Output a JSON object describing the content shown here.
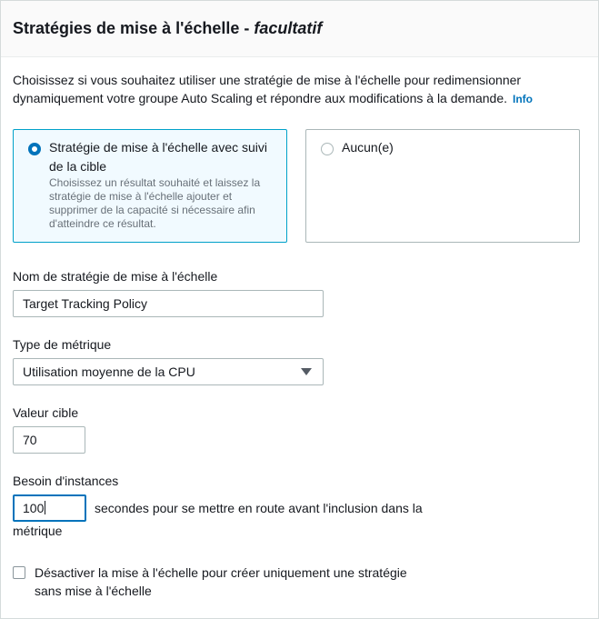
{
  "section": {
    "title": "Stratégies de mise à l'échelle - ",
    "title_italic": "facultatif",
    "description": "Choisissez si vous souhaitez utiliser une stratégie de mise à l'échelle pour redimensionner dynamiquement votre groupe Auto Scaling et répondre aux modifications à la demande.",
    "info_link": "Info"
  },
  "policy_options": [
    {
      "label": "Stratégie de mise à l'échelle avec suivi de la cible",
      "description": "Choisissez un résultat souhaité et laissez la stratégie de mise à l'échelle ajouter et supprimer de la capacité si nécessaire afin d'atteindre ce résultat.",
      "selected": true
    },
    {
      "label": "Aucun(e)",
      "selected": false
    }
  ],
  "policy_name": {
    "label": "Nom de stratégie de mise à l'échelle",
    "value": "Target Tracking Policy"
  },
  "metric_type": {
    "label": "Type de métrique",
    "value": "Utilisation moyenne de la CPU"
  },
  "target_value": {
    "label": "Valeur cible",
    "value": "70"
  },
  "instance_warmup": {
    "label": "Besoin d'instances",
    "value": "100",
    "suffix_line1": "secondes pour se mettre en route avant l'inclusion dans la",
    "suffix_line2": "métrique"
  },
  "disable_scale_in": {
    "label": "Désactiver la mise à l'échelle pour créer uniquement une stratégie sans mise à l'échelle",
    "checked": false
  },
  "colors": {
    "accent": "#0073bb",
    "selected_border": "#00a1c9",
    "selected_bg": "#f1faff"
  }
}
